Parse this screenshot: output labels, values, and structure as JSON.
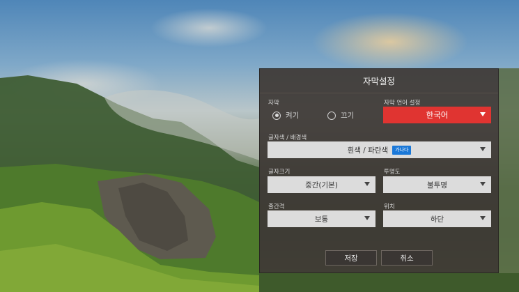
{
  "dialog": {
    "title": "자막설정",
    "subtitle": {
      "label": "자막",
      "on_label": "켜기",
      "off_label": "끄기",
      "selected": "켜기"
    },
    "language": {
      "label": "자막 언어 설정",
      "value": "한국어",
      "accent_color": "#e03431"
    },
    "color": {
      "label": "글자색 / 배경색",
      "value": "흰색 / 파란색",
      "preview_text": "가나다",
      "preview_bg": "#1a78d8"
    },
    "font_size": {
      "label": "글자크기",
      "value": "중간(기본)"
    },
    "opacity": {
      "label": "투명도",
      "value": "불투명"
    },
    "line_spacing": {
      "label": "줄간격",
      "value": "보통"
    },
    "position": {
      "label": "위치",
      "value": "하단"
    },
    "buttons": {
      "save": "저장",
      "cancel": "취소"
    }
  },
  "icons": {
    "dropdown": "chevron-down-icon",
    "radio_on": "radio-selected-icon",
    "radio_off": "radio-unselected-icon"
  }
}
